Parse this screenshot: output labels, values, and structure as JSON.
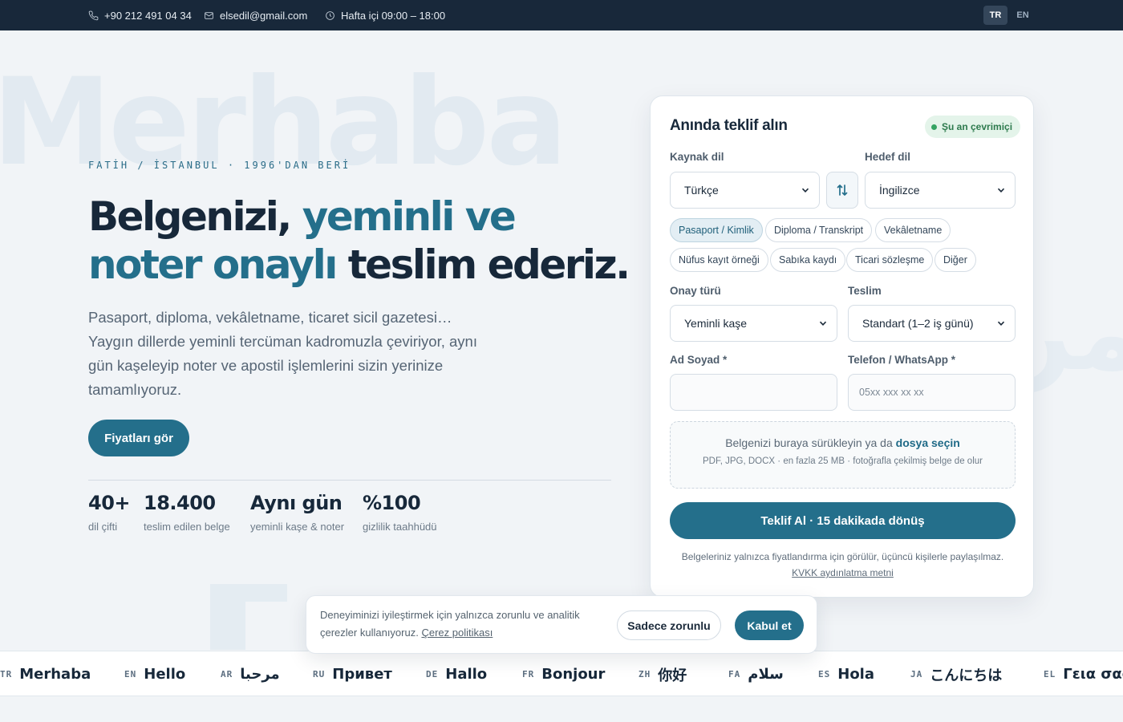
{
  "topbar": {
    "phone": "+90 212 491 04 34",
    "email": "elsedil@gmail.com",
    "hours": "Hafta içi 09:00 – 18:00",
    "lang_active": "TR",
    "lang_other": "EN"
  },
  "watermarks": {
    "word1": "Merhaba",
    "word2": "مر"
  },
  "hero": {
    "eyebrow": "FATİH / İSTANBUL · 1996'DAN BERİ",
    "title_part1": "Belgenizi,",
    "title_part2": "yeminli ve",
    "title_part3": "noter onaylı",
    "title_part4": "teslim ederiz.",
    "description": "Pasaport, diploma, vekâletname, ticaret sicil gazetesi… Yaygın dillerde yeminli tercüman kadromuzla çeviriyor, aynı gün kaşeleyip noter ve apostil işlemlerini sizin yerinize tamamlıyoruz.",
    "cta": "Fiyatları gör",
    "stats": [
      {
        "value": "40+",
        "label": "dil çifti"
      },
      {
        "value": "18.400",
        "label": "teslim edilen belge"
      },
      {
        "value": "Aynı gün",
        "label": "yeminli kaşe & noter"
      },
      {
        "value": "%100",
        "label": "gizlilik taahhüdü"
      }
    ]
  },
  "form": {
    "title": "Anında teklif alın",
    "online_badge": "Şu an çevrimiçi",
    "source_label": "Kaynak dil",
    "source_value": "Türkçe",
    "target_label": "Hedef dil",
    "target_value": "İngilizce",
    "doc_types": [
      "Pasaport / Kimlik",
      "Diploma / Transkript",
      "Vekâletname",
      "Nüfus kayıt örneği",
      "Sabıka kaydı",
      "Ticari sözleşme",
      "Diğer"
    ],
    "approval_label": "Onay türü",
    "approval_value": "Yeminli kaşe",
    "delivery_label": "Teslim",
    "delivery_value": "Standart (1–2 iş günü)",
    "name_label": "Ad Soyad *",
    "name_value": "",
    "phone_label": "Telefon / WhatsApp *",
    "phone_placeholder": "05xx xxx xx xx",
    "upload_text": "Belgenizi buraya sürükleyin ya da",
    "upload_link": "dosya seçin",
    "upload_hint": "PDF, JPG, DOCX · en fazla 25 MB · fotoğrafla çekilmiş belge de olur",
    "submit": "Teklif Al · 15 dakikada dönüş",
    "privacy_text": "Belgeleriniz yalnızca fiyatlandırma için görülür, üçüncü kişilerle paylaşılmaz.",
    "privacy_link": "KVKK aydınlatma metni"
  },
  "cookie": {
    "text": "Deneyiminizi iyileştirmek için yalnızca zorunlu ve analitik çerezler kullanıyoruz.",
    "link": "Çerez politikası",
    "essential": "Sadece zorunlu",
    "accept": "Kabul et"
  },
  "marquee": [
    {
      "code": "TR",
      "word": "Merhaba"
    },
    {
      "code": "EN",
      "word": "Hello"
    },
    {
      "code": "AR",
      "word": "مرحبا"
    },
    {
      "code": "RU",
      "word": "Привет"
    },
    {
      "code": "DE",
      "word": "Hallo"
    },
    {
      "code": "FR",
      "word": "Bonjour"
    },
    {
      "code": "ZH",
      "word": "你好"
    },
    {
      "code": "FA",
      "word": "سلام"
    },
    {
      "code": "ES",
      "word": "Hola"
    },
    {
      "code": "JA",
      "word": "こんにちは"
    },
    {
      "code": "EL",
      "word": "Γεια σας"
    }
  ],
  "colors": {
    "accent": "#246f8b",
    "navy": "#18283a",
    "online": "#34a362"
  }
}
